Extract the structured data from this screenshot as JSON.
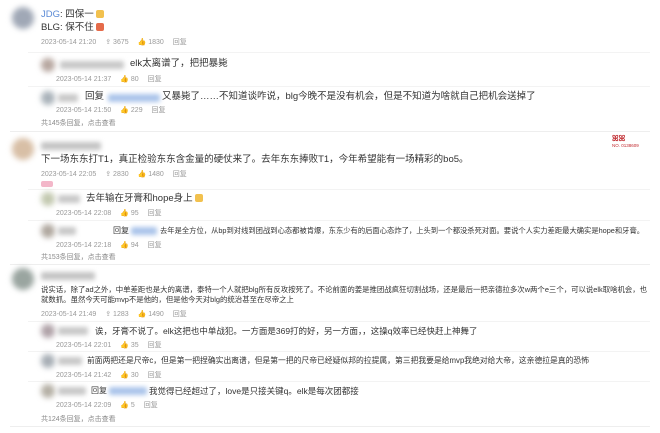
{
  "c1": {
    "user_prefix": "JDG",
    "line1": ": 四保一",
    "line2": "BLG: 保不住",
    "meta": [
      "2023-05-14 21:20",
      "3675",
      "1830",
      "回复"
    ],
    "replies": [
      {
        "text": "elk太离谱了，把把暴毙",
        "meta": [
          "2023-05-14 21:37",
          "80",
          "回复"
        ]
      },
      {
        "prefix": "回复",
        "text": "又暴毙了……不知道谈咋说，blg今晚不是没有机会，但是不知道为啥就自己把机会送掉了",
        "meta": [
          "2023-05-14 21:50",
          "229",
          "回复"
        ]
      }
    ],
    "more": "共145条回复，点击查看"
  },
  "c2": {
    "text": "下一场东东打T1，真正检验东东含金量的硬仗来了。去年东东捧败T1，今年希望能有一场精彩的bo5。",
    "badge": "NO. 0138609",
    "meta": [
      "2023-05-14 22:05",
      "2830",
      "1480",
      "回复"
    ],
    "replies": [
      {
        "text": "去年输在牙膏和hope身上",
        "meta": [
          "2023-05-14 22:08",
          "95",
          "回复"
        ]
      },
      {
        "prefix": "回复",
        "text": "去年是全方位，从bp到对线到团战到心态都被肯爆，东东少有的后面心态炸了，上头到一个都没杀死对面。要说个人实力差距最大确实是hope和牙膏。",
        "meta": [
          "2023-05-14 22:18",
          "94",
          "回复"
        ]
      }
    ],
    "more": "共153条回复，点击查看"
  },
  "c3": {
    "text": "说实话，除了ad之外，中单差距也是大的离谱，泰特一个人就把blg所有反攻按死了。不论前面的姜是推团战疯狂切割战场，还是最后一把亲德拉多次w两个e三个，可以说elk取啥机会，也就数抓。虽然今天可能mvp不是他的，但是他今天对blg的统治甚至在尽帝之上",
    "meta": [
      "2023-05-14 21:49",
      "1283",
      "1490",
      "回复"
    ],
    "replies": [
      {
        "text": "诶，牙膏不说了。elk这把也中单战犯。一方面是369打的好，另一方面，，这操q效率已经快赶上神舞了",
        "meta": [
          "2023-05-14 22:01",
          "35",
          "回复"
        ]
      },
      {
        "text": "前面两把还是尺帝c，但是第一把捏确实出离谱，但是第一把的尺帝已经疑似邦的拉提属，第三把我要是给mvp我绝对给大帝，这亲德拉是真的恐怖",
        "meta": [
          "2023-05-14 21:42",
          "30",
          "回复"
        ]
      },
      {
        "prefix": "回复",
        "text": "我觉得已经超过了，love是只接关键q。elk是每次团都接",
        "meta": [
          "2023-05-14 22:09",
          "5",
          "回复"
        ]
      }
    ],
    "more": "共124条回复，点击查看"
  }
}
